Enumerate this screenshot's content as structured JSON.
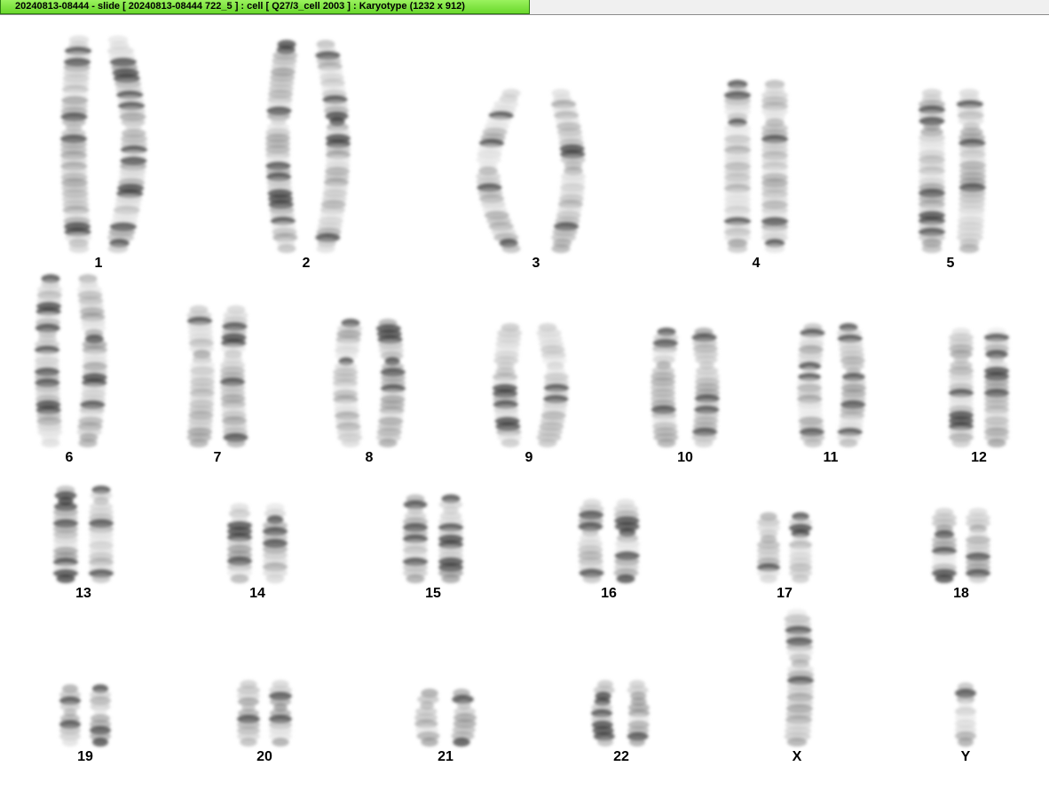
{
  "window": {
    "title": "20240813-08444 - slide [ 20240813-08444 722_5 ] : cell [ Q27/3_cell 2003 ] : Karyotype  (1232 x 912)"
  },
  "karyotype": {
    "chromosomes": [
      {
        "id": "1",
        "label": "1",
        "count": 2
      },
      {
        "id": "2",
        "label": "2",
        "count": 2
      },
      {
        "id": "3",
        "label": "3",
        "count": 2
      },
      {
        "id": "4",
        "label": "4",
        "count": 2
      },
      {
        "id": "5",
        "label": "5",
        "count": 2
      },
      {
        "id": "6",
        "label": "6",
        "count": 2
      },
      {
        "id": "7",
        "label": "7",
        "count": 2
      },
      {
        "id": "8",
        "label": "8",
        "count": 2
      },
      {
        "id": "9",
        "label": "9",
        "count": 2
      },
      {
        "id": "10",
        "label": "10",
        "count": 2
      },
      {
        "id": "11",
        "label": "11",
        "count": 2
      },
      {
        "id": "12",
        "label": "12",
        "count": 2
      },
      {
        "id": "13",
        "label": "13",
        "count": 2
      },
      {
        "id": "14",
        "label": "14",
        "count": 2
      },
      {
        "id": "15",
        "label": "15",
        "count": 2
      },
      {
        "id": "16",
        "label": "16",
        "count": 2
      },
      {
        "id": "17",
        "label": "17",
        "count": 2
      },
      {
        "id": "18",
        "label": "18",
        "count": 2
      },
      {
        "id": "19",
        "label": "19",
        "count": 2
      },
      {
        "id": "20",
        "label": "20",
        "count": 2
      },
      {
        "id": "21",
        "label": "21",
        "count": 2
      },
      {
        "id": "22",
        "label": "22",
        "count": 2
      },
      {
        "id": "X",
        "label": "X",
        "count": 1
      },
      {
        "id": "Y",
        "label": "Y",
        "count": 1
      }
    ]
  },
  "colors": {
    "title_tab": "#6ad82c",
    "chromatin_light": "#cfcfcf",
    "chromatin_dark": "#3a3a3a",
    "background": "#ffffff"
  }
}
